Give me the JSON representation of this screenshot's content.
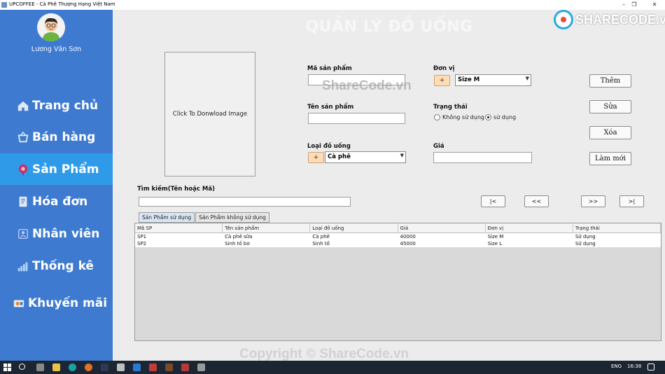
{
  "window": {
    "title": "UPCOFFEE - Cà Phê Thượng Hạng Việt Nam"
  },
  "sidebar": {
    "user_name": "Lương Văn Sơn",
    "items": [
      {
        "label": "Trang chủ",
        "icon": "home-icon"
      },
      {
        "label": "Bán hàng",
        "icon": "basket-icon"
      },
      {
        "label": "Sản Phẩm",
        "icon": "product-icon",
        "active": true
      },
      {
        "label": "Hóa đơn",
        "icon": "invoice-icon"
      },
      {
        "label": "Nhân viên",
        "icon": "employee-icon"
      },
      {
        "label": "Thống kê",
        "icon": "chart-icon"
      },
      {
        "label": "Khuyến mãi",
        "icon": "promotion-icon"
      }
    ]
  },
  "main": {
    "title": "QUẢN LÝ ĐỒ UỐNG",
    "image_placeholder": "Click To Donwload Image",
    "brand": "SHARECODE.vn"
  },
  "form": {
    "product_code_label": "Mã sản phẩm",
    "product_code_value": "",
    "product_name_label": "Tên sản phẩm",
    "product_name_value": "",
    "drink_type_label": "Loại đồ uống",
    "drink_type_value": "Cà phê",
    "unit_label": "Đơn vị",
    "unit_value": "Size M",
    "status_label": "Trạng thái",
    "status_options": [
      "Không sử dụng",
      "sử dụng"
    ],
    "status_selected": "sử dụng",
    "price_label": "Giá",
    "price_value": "",
    "plus_label": "+"
  },
  "actions": {
    "add": "Thêm",
    "edit": "Sửa",
    "delete": "Xóa",
    "refresh": "Làm mới"
  },
  "search": {
    "label": "Tìm kiếm(Tên hoặc Mã)",
    "value": ""
  },
  "pagination": {
    "first": "|<",
    "prev": "<<",
    "next": ">>",
    "last": ">|"
  },
  "tabs": [
    "Sản Phẩm sử dụng",
    "Sản Phẩm không sử dụng"
  ],
  "table": {
    "columns": [
      "Mã SP",
      "Tên sản phẩm",
      "Loại đồ uống",
      "Giá",
      "Đơn vị",
      "Trạng thái"
    ],
    "rows": [
      [
        "SP1",
        "Cà phê sữa",
        "Cà phê",
        "40000",
        "Size M",
        "Sử dụng"
      ],
      [
        "SP2",
        "Sinh tố bơ",
        "Sinh tố",
        "45000",
        "Size L",
        "Sử dụng"
      ]
    ]
  },
  "watermarks": {
    "middle": "ShareCode.vn",
    "bottom": "Copyright © ShareCode.vn"
  },
  "taskbar": {
    "language": "ENG",
    "time": "16:38"
  },
  "colors": {
    "sidebar": "#3e7bd0",
    "sidebar_active": "#2f9be8",
    "panel": "#ececec",
    "plus_button": "#ffdcb2"
  }
}
